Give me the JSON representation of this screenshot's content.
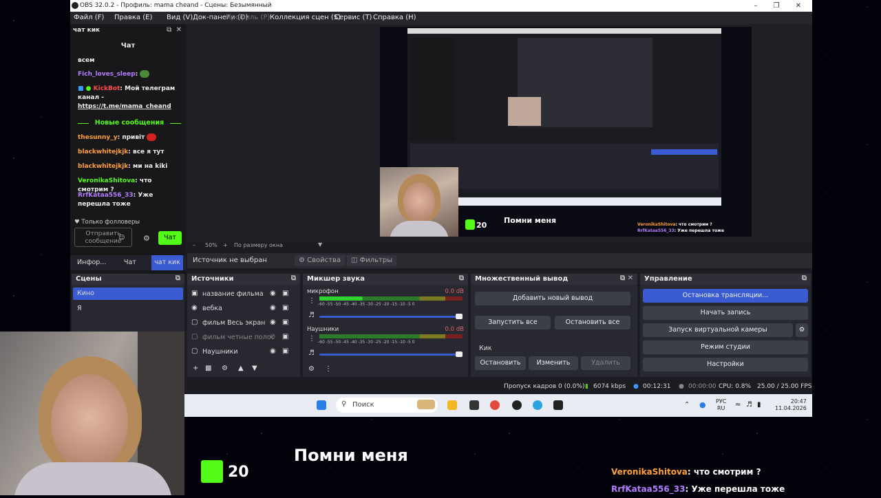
{
  "window": {
    "title": "OBS 32.0.2 - Профиль: mama cheand - Сцены: Безымянный"
  },
  "menu": [
    "Файл (F)",
    "Правка (E)",
    "Вид (V)",
    "Док-панели (D)",
    "Профиль (P)",
    "Коллекция сцен (S)",
    "Сервис (T)",
    "Справка (H)"
  ],
  "chat": {
    "dock_title": "чат кик",
    "header": "Чат",
    "messages": [
      {
        "text": "всем"
      },
      {
        "nick": "Fich_loves_sleep",
        "text": ":"
      },
      {
        "nick": "KickBot",
        "text": ": Мой телеграм канал - ",
        "link": "https://t.me/mama_cheand"
      },
      {
        "nick": "thesunny_y",
        "text": ": привіт"
      },
      {
        "nick": "blackwhitejkjk",
        "text": ": все я тут"
      },
      {
        "nick": "blackwhitejkjk",
        "text": ": ми на kiki"
      },
      {
        "nick": "VeronikaShitova",
        "text": ": что смотрим ?"
      },
      {
        "nick": "RrfKataa556_33",
        "text": ": Уже перешла тоже"
      }
    ],
    "new_messages": "Новые сообщения",
    "followers_only": "Только фолловеры",
    "input_placeholder": "Отправить сообщение",
    "send_button": "Чат",
    "tabs": [
      "Инфор...",
      "Чат",
      "чат кик"
    ]
  },
  "preview": {
    "zoom": "50%",
    "fit": "По размеру окна",
    "overlay_num": "20",
    "song": "Помни меня",
    "overlay_chat": [
      {
        "nick": "VeronikaShitova",
        "text": ": что смотрим ?"
      },
      {
        "nick": "RrfKataa556_33",
        "text": ": Уже перешла тоже"
      }
    ]
  },
  "source_bar": {
    "label": "Источник не выбран",
    "properties": "Свойства",
    "filters": "Фильтры"
  },
  "scenes": {
    "title": "Сцены",
    "items": [
      "Кино",
      "Я"
    ]
  },
  "sources": {
    "title": "Источники",
    "items": [
      "название фильма",
      "вебка",
      "фильм Весь экран",
      "фильм четные полос",
      "Наушники"
    ]
  },
  "mixer": {
    "title": "Микшер звука",
    "channels": [
      {
        "name": "микрофон",
        "db": "0.0 dB"
      },
      {
        "name": "Наушники",
        "db": "0.0 dB"
      }
    ],
    "ticks": "-60 -55 -50 -45 -40 -35 -30 -25 -20 -15 -10 -5 0"
  },
  "multi": {
    "title": "Множественный вывод",
    "add": "Добавить новый вывод",
    "start_all": "Запустить все",
    "stop_all": "Остановить все",
    "target": "Кик",
    "stop": "Остановить",
    "edit": "Изменить",
    "delete": "Удалить"
  },
  "controls": {
    "title": "Управление",
    "stop_stream": "Остановка трансляции...",
    "start_record": "Начать запись",
    "virtual_cam": "Запуск виртуальной камеры",
    "studio": "Режим студии",
    "settings": "Настройки"
  },
  "status": {
    "dropped": "Пропуск кадров 0 (0.0%)",
    "bitrate": "6074 kbps",
    "stream_time": "00:12:31",
    "rec_time": "00:00:00",
    "cpu": "CPU: 0.8%",
    "fps": "25.00 / 25.00 FPS"
  },
  "taskbar": {
    "search": "Поиск",
    "lang1": "РУС",
    "lang2": "RU",
    "time": "20:47",
    "date": "11.04.2026"
  },
  "overlay": {
    "num": "20",
    "song": "Помни меня",
    "chat": [
      {
        "nick": "VeronikaShitova",
        "text": ": что смотрим ?"
      },
      {
        "nick": "RrfKataa556_33",
        "text": ": Уже перешла тоже"
      }
    ]
  },
  "colors": {
    "kick_green": "#53fc18",
    "accent": "#3a5bd1",
    "nick_green": "#53fc18",
    "nick_purple": "#b57cff",
    "nick_orange": "#ff9f3a"
  }
}
